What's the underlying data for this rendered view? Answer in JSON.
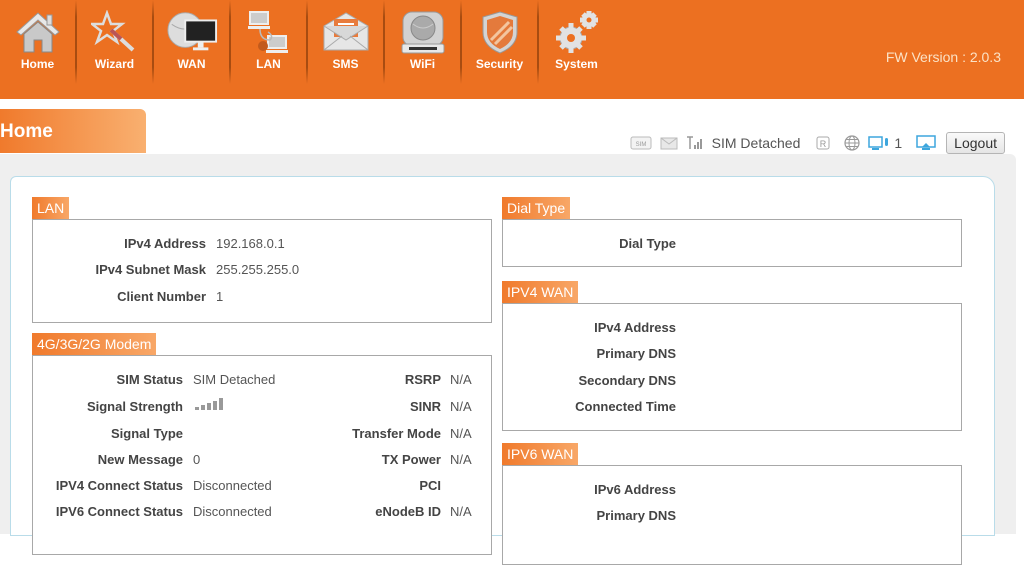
{
  "nav": {
    "items": [
      {
        "label": "Home",
        "icon": "home-icon"
      },
      {
        "label": "Wizard",
        "icon": "wizard-wand-icon"
      },
      {
        "label": "WAN",
        "icon": "wan-globe-monitor-icon"
      },
      {
        "label": "LAN",
        "icon": "lan-computers-icon"
      },
      {
        "label": "SMS",
        "icon": "envelope-icon"
      },
      {
        "label": "WiFi",
        "icon": "wifi-router-icon"
      },
      {
        "label": "Security",
        "icon": "shield-icon"
      },
      {
        "label": "System",
        "icon": "gears-icon"
      }
    ],
    "fw_version": "FW Version : 2.0.3"
  },
  "page": {
    "title": "Home"
  },
  "status_bar": {
    "sim_icon_text": "SIM",
    "network_status": "SIM Detached",
    "roaming_text": "R",
    "connected_clients": "1",
    "logout_label": "Logout"
  },
  "lan": {
    "title": "LAN",
    "rows": [
      {
        "label": "IPv4 Address",
        "value": "192.168.0.1"
      },
      {
        "label": "IPv4 Subnet Mask",
        "value": "255.255.255.0"
      },
      {
        "label": "Client Number",
        "value": "1"
      }
    ]
  },
  "modem": {
    "title": "4G/3G/2G Modem",
    "left": [
      {
        "label": "SIM Status",
        "value": "SIM Detached"
      },
      {
        "label": "Signal Strength",
        "value": ""
      },
      {
        "label": "Signal Type",
        "value": ""
      },
      {
        "label": "New Message",
        "value": "0"
      },
      {
        "label": "IPV4 Connect Status",
        "value": "Disconnected"
      },
      {
        "label": "IPV6 Connect Status",
        "value": "Disconnected"
      }
    ],
    "right": [
      {
        "label": "RSRP",
        "value": "N/A"
      },
      {
        "label": "SINR",
        "value": "N/A"
      },
      {
        "label": "Transfer Mode",
        "value": "N/A"
      },
      {
        "label": "TX Power",
        "value": "N/A"
      },
      {
        "label": "PCI",
        "value": ""
      },
      {
        "label": "eNodeB ID",
        "value": "N/A"
      }
    ],
    "signal_bars": 0
  },
  "dial_type": {
    "title": "Dial Type",
    "rows": [
      {
        "label": "Dial Type",
        "value": ""
      }
    ]
  },
  "ipv4_wan": {
    "title": "IPV4 WAN",
    "rows": [
      {
        "label": "IPv4 Address",
        "value": ""
      },
      {
        "label": "Primary DNS",
        "value": ""
      },
      {
        "label": "Secondary DNS",
        "value": ""
      },
      {
        "label": "Connected Time",
        "value": ""
      }
    ]
  },
  "ipv6_wan": {
    "title": "IPV6 WAN",
    "rows": [
      {
        "label": "IPv6 Address",
        "value": ""
      },
      {
        "label": "Primary DNS",
        "value": ""
      }
    ]
  },
  "colors": {
    "brand_orange": "#ec7021",
    "header_text": "#fbe2c6",
    "panel_border": "#b9dce9"
  }
}
